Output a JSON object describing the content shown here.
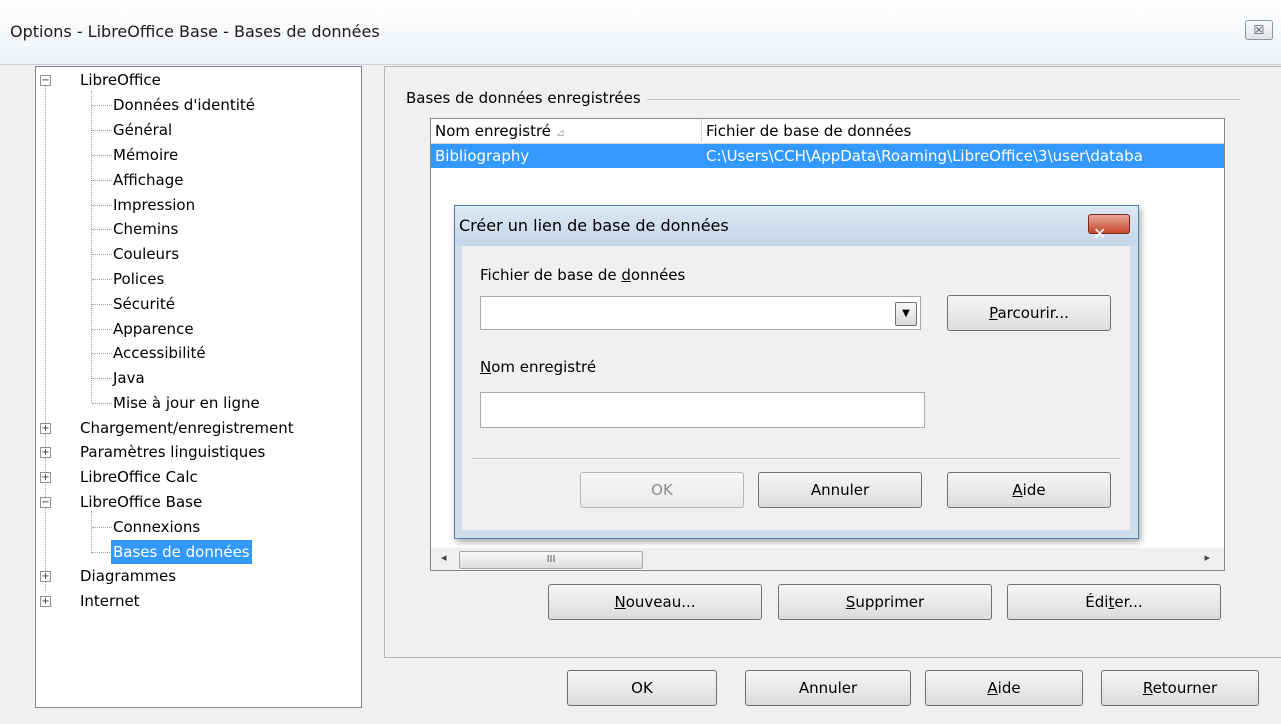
{
  "window": {
    "title": "Options - LibreOffice Base - Bases de données",
    "close_glyph": "☒"
  },
  "tree": {
    "libreoffice": "LibreOffice",
    "libreoffice_children": [
      "Données d'identité",
      "Général",
      "Mémoire",
      "Affichage",
      "Impression",
      "Chemins",
      "Couleurs",
      "Polices",
      "Sécurité",
      "Apparence",
      "Accessibilité",
      "Java",
      "Mise à jour en ligne"
    ],
    "chargement": "Chargement/enregistrement",
    "parametres": "Paramètres linguistiques",
    "calc": "LibreOffice Calc",
    "base": "LibreOffice Base",
    "base_children": [
      "Connexions",
      "Bases de données"
    ],
    "diagrammes": "Diagrammes",
    "internet": "Internet"
  },
  "registered": {
    "group_title": "Bases de données enregistrées",
    "col_name": "Nom enregistré",
    "col_file": "Fichier de base de données",
    "rows": [
      {
        "name": "Bibliography",
        "file": "C:\\Users\\CCH\\AppData\\Roaming\\LibreOffice\\3\\user\\databa"
      }
    ],
    "scroll_thumb": "III",
    "buttons": {
      "new_pre": "",
      "new_u": "N",
      "new_post": "ouveau...",
      "delete_pre": "",
      "delete_u": "S",
      "delete_post": "upprimer",
      "edit_pre": "Édi",
      "edit_u": "t",
      "edit_post": "er..."
    }
  },
  "dialog": {
    "title": "Créer un lien de base de données",
    "file_label_pre": "Fichier de base de ",
    "file_label_u": "d",
    "file_label_post": "onnées",
    "file_value": "",
    "browse_u": "P",
    "browse_post": "arcourir...",
    "name_label_u": "N",
    "name_label_post": "om enregistré",
    "name_value": "",
    "ok": "OK",
    "cancel": "Annuler",
    "help_u": "A",
    "help_post": "ide"
  },
  "footer": {
    "ok": "OK",
    "cancel": "Annuler",
    "help_u": "A",
    "help_post": "ide",
    "back_u": "R",
    "back_post": "etourner"
  }
}
